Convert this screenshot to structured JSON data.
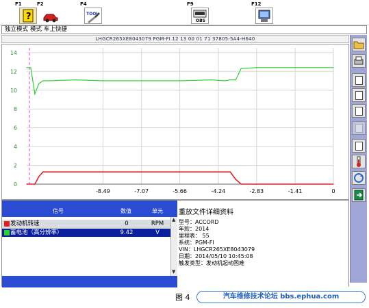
{
  "toolbar": {
    "keys": [
      {
        "label": "F1",
        "icon": "help-icon"
      },
      {
        "label": "F2",
        "icon": "car-icon"
      },
      {
        "label": "F4",
        "icon": "tool-icon"
      },
      {
        "label": "F9",
        "icon": "obd-icon"
      },
      {
        "label": "F12",
        "icon": "exit-computer-icon"
      }
    ],
    "tool_text": "TOOL",
    "obd_text": "OBS"
  },
  "modebar": {
    "part1": "独立模式",
    "part2": "模式",
    "part3": "车上快捷"
  },
  "header": {
    "text": "LHGCR265XE8043079  PGM-FI  12 13 00 01 71  37805-5A4-H640"
  },
  "chart_data": {
    "type": "line",
    "x": [
      -11.3,
      -11.15,
      -11.0,
      -10.85,
      -10.7,
      -10.5,
      -9.5,
      -8.49,
      -7.07,
      -5.66,
      -4.5,
      -4.0,
      -3.8,
      -3.6,
      -3.4,
      -2.83,
      -1.41,
      0
    ],
    "xlim": [
      -11.3,
      0
    ],
    "ylim": [
      0,
      14.5
    ],
    "x_ticks": [
      "-8.49",
      "-7.07",
      "-5.66",
      "-4.24",
      "-2.83",
      "-1.41",
      "0"
    ],
    "y_ticks": [
      "0",
      "2",
      "4",
      "6",
      "8",
      "10",
      "12",
      "14"
    ],
    "cursor_x": -11.2,
    "grid": true,
    "series": [
      {
        "name": "发动机转速",
        "color": "#e02020",
        "values": [
          0,
          0,
          0,
          0.8,
          1.3,
          1.3,
          1.3,
          1.3,
          1.3,
          1.3,
          1.3,
          1.3,
          1.3,
          0.5,
          0,
          0,
          0,
          0
        ]
      },
      {
        "name": "蓄电池（高分辨率）",
        "color": "#2ed12e",
        "values": [
          12.4,
          12.4,
          9.6,
          10.7,
          11.0,
          11.0,
          11.1,
          11.0,
          11.0,
          11.0,
          11.1,
          11.0,
          11.1,
          11.1,
          12.3,
          12.4,
          12.4,
          12.4
        ]
      }
    ]
  },
  "signals": {
    "head_signal": "信号",
    "head_value": "数值",
    "head_unit": "单元",
    "rows": [
      {
        "name": "发动机转速",
        "value": "0",
        "unit": "RPM",
        "swatch": "#e02020",
        "bg": "#d8dbe2",
        "fg": "#000000"
      },
      {
        "name": "蓄电池（高分辨率）",
        "value": "9.42",
        "unit": "V",
        "swatch": "#2ed12e",
        "bg": "#0a1f9c",
        "fg": "#ffffff"
      }
    ]
  },
  "replay": {
    "title": "重放文件详细资料",
    "lines": [
      "型号：ACCORD",
      "年款：2014",
      "里程表：  55",
      "系统：PGM-FI",
      "VIN：LHGCR265XE8043079",
      "日期：2014/05/10 10:45:08",
      "触发类型：发动机起动困难"
    ]
  },
  "sidebar": {
    "icons": [
      "folder-open-icon",
      "print-icon",
      "config-icon",
      "list-icon",
      "scale-icon",
      "disabled-icon",
      "tools-icon",
      "thermometer-icon",
      "refresh-icon",
      "exit-icon"
    ]
  },
  "caption": {
    "figure": "图 4",
    "watermark": "汽车维修技术论坛 bbs.ephua.com"
  },
  "colors": {
    "toolbar_blue": "#2a4cd3",
    "sidebar": "#a0a6d6",
    "rpm_line": "#e02020",
    "battery_line": "#2ed12e",
    "cursor": "#e040e0"
  }
}
